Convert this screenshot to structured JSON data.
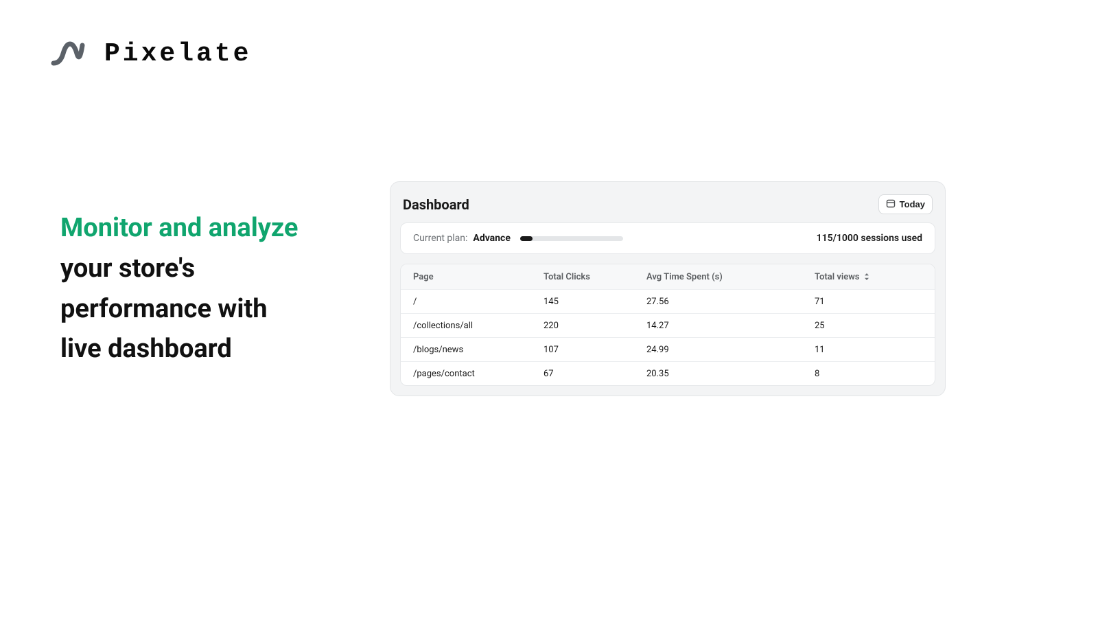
{
  "brand": {
    "name": "Pixelate"
  },
  "tagline": {
    "highlight": "Monitor and analyze",
    "lines": [
      "your store's",
      "performance with",
      "live dashboard"
    ]
  },
  "dashboard": {
    "title": "Dashboard",
    "date_button_label": "Today",
    "plan": {
      "label": "Current plan:",
      "name": "Advance",
      "sessions_text": "115/1000 sessions used",
      "progress_percent": 11.5
    },
    "table": {
      "headers": {
        "page": "Page",
        "total_clicks": "Total Clicks",
        "avg_time": "Avg Time Spent (s)",
        "total_views": "Total views"
      },
      "rows": [
        {
          "page": "/",
          "clicks": "145",
          "time": "27.56",
          "views": "71"
        },
        {
          "page": "/collections/all",
          "clicks": "220",
          "time": "14.27",
          "views": "25"
        },
        {
          "page": "/blogs/news",
          "clicks": "107",
          "time": "24.99",
          "views": "11"
        },
        {
          "page": "/pages/contact",
          "clicks": "67",
          "time": "20.35",
          "views": "8"
        }
      ]
    }
  }
}
